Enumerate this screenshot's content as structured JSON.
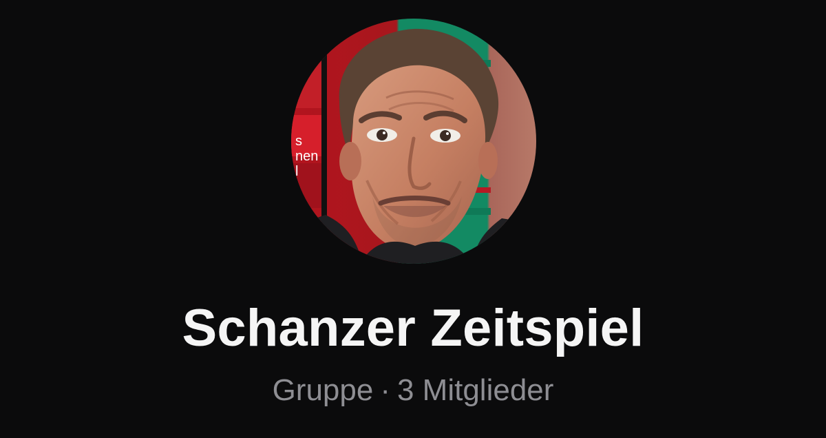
{
  "group": {
    "name": "Schanzer Zeitspiel",
    "type": "Gruppe",
    "separator": "·",
    "member_count": "3 Mitglieder"
  },
  "avatar": {
    "overlay_text": [
      "s",
      "nen",
      "l"
    ],
    "colors": {
      "red": "#b3141e",
      "green": "#138a63",
      "skin": "#c78468",
      "hair": "#5a4334",
      "shirt": "#1f1f22"
    }
  }
}
